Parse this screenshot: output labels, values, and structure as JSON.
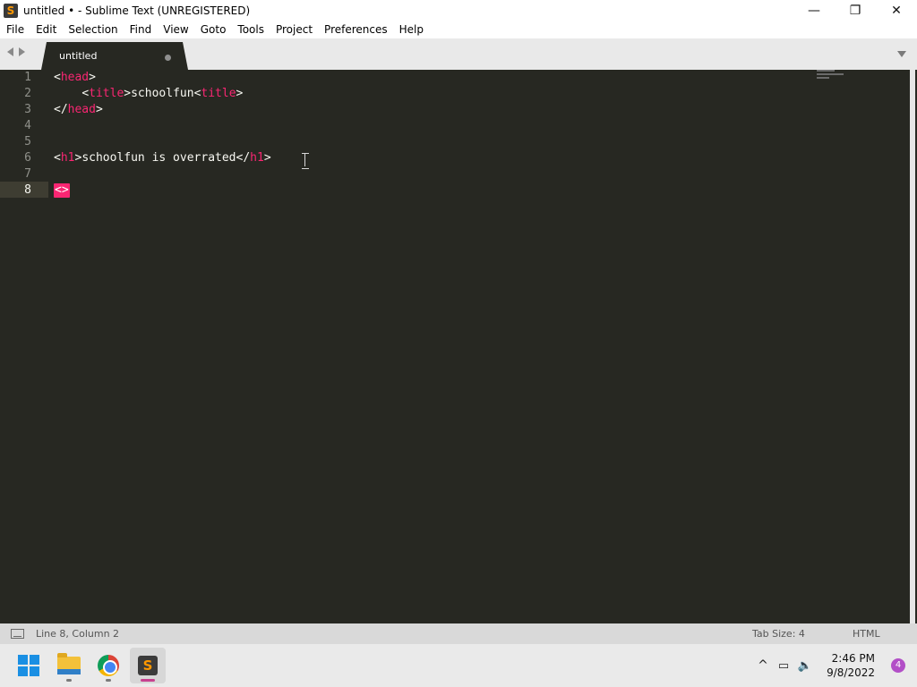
{
  "window": {
    "title": "untitled • - Sublime Text (UNREGISTERED)",
    "controls": {
      "minimize": "—",
      "maximize": "❐",
      "close": "✕"
    }
  },
  "menu": [
    "File",
    "Edit",
    "Selection",
    "Find",
    "View",
    "Goto",
    "Tools",
    "Project",
    "Preferences",
    "Help"
  ],
  "tabs": [
    {
      "label": "untitled",
      "modified": true
    }
  ],
  "editor": {
    "line_numbers": [
      "1",
      "2",
      "3",
      "4",
      "5",
      "6",
      "7",
      "8"
    ],
    "active_line": "8",
    "lines": {
      "l1": {
        "open": "<",
        "tag": "head",
        "close": ">"
      },
      "l2": {
        "indent": "    ",
        "open": "<",
        "tag": "title",
        "gt": ">",
        "text": "schoolfun",
        "open2": "<",
        "tag2": "title",
        "close": ">"
      },
      "l3": {
        "open": "</",
        "tag": "head",
        "close": ">"
      },
      "l6": {
        "open": "<",
        "tag": "h1",
        "gt": ">",
        "text": "schoolfun is overrated",
        "open2": "</",
        "tag2": "h1",
        "close": ">"
      },
      "l8": {
        "cursor_text": "<>"
      }
    },
    "colors": {
      "background": "#272822",
      "tag": "#f92672",
      "text": "#f8f8f2"
    }
  },
  "status": {
    "position": "Line 8, Column 2",
    "tab_size": "Tab Size: 4",
    "syntax": "HTML"
  },
  "taskbar": {
    "apps": [
      "start-icon",
      "file-explorer-icon",
      "chrome-icon",
      "sublime-text-icon"
    ],
    "tray": {
      "chevron": "^",
      "time": "2:46 PM",
      "date": "9/8/2022",
      "notifications": "4"
    }
  }
}
